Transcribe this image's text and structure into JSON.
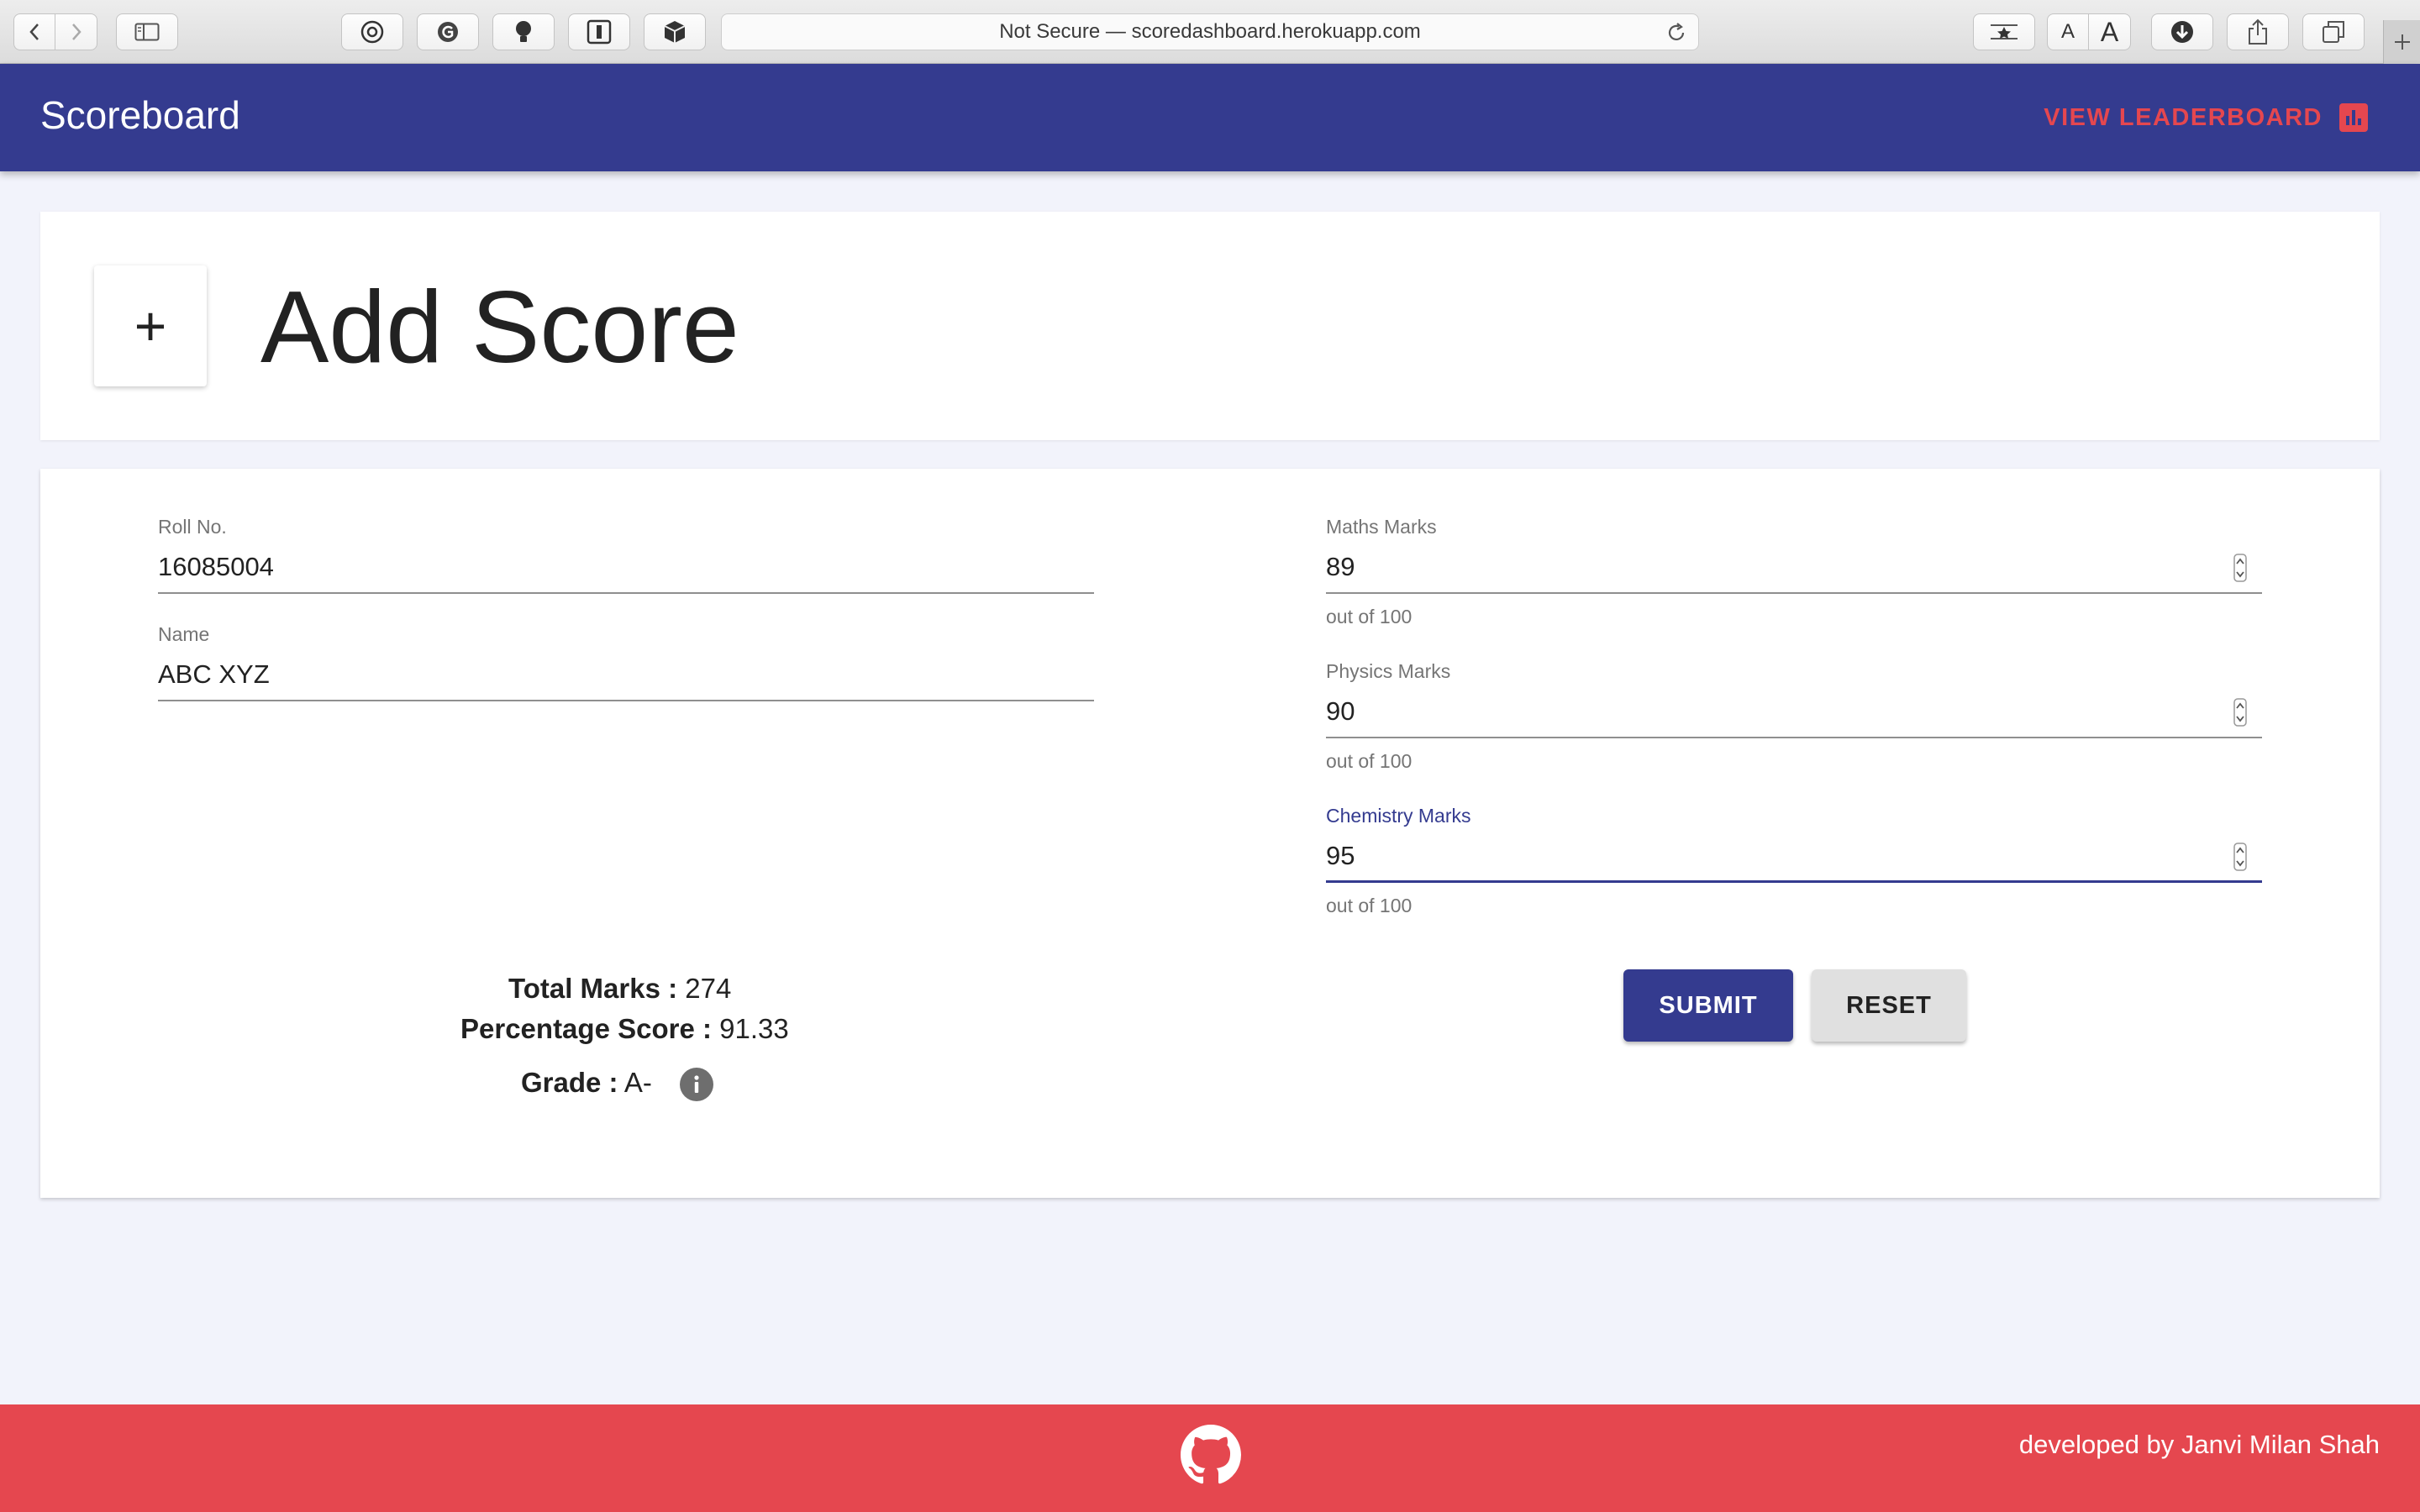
{
  "browser": {
    "address": "Not Secure — scoredashboard.herokuapp.com",
    "font_small": "A",
    "font_large": "A"
  },
  "appbar": {
    "title": "Scoreboard",
    "leaderboard_label": "VIEW LEADERBOARD",
    "leaderboard_icon": "bar-chart-icon"
  },
  "header": {
    "add_glyph": "+",
    "title": "Add Score"
  },
  "form": {
    "roll": {
      "label": "Roll No.",
      "value": "16085004"
    },
    "name": {
      "label": "Name",
      "value": "ABC XYZ"
    },
    "maths": {
      "label": "Maths Marks",
      "value": "89",
      "help": "out of 100"
    },
    "physics": {
      "label": "Physics Marks",
      "value": "90",
      "help": "out of 100"
    },
    "chemistry": {
      "label": "Chemistry Marks",
      "value": "95",
      "help": "out of 100"
    }
  },
  "summary": {
    "total_label": "Total Marks :",
    "total_value": "274",
    "percent_label": "Percentage Score :",
    "percent_value": "91.33",
    "grade_label": "Grade :",
    "grade_value": "A-"
  },
  "actions": {
    "submit": "SUBMIT",
    "reset": "RESET"
  },
  "footer": {
    "credit": "developed by Janvi Milan Shah"
  },
  "colors": {
    "primary": "#343b8f",
    "accent": "#e5474f",
    "background": "#f2f3fb"
  }
}
